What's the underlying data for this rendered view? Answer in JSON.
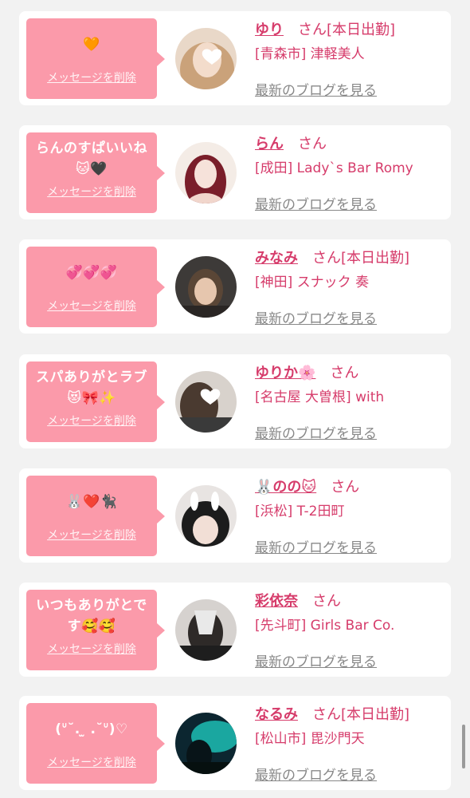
{
  "cards": [
    {
      "message": "🧡",
      "delete_label": "メッセージを削除",
      "name": "ゆり",
      "honorific": "さん",
      "status": "[本日出勤]",
      "shop": "[青森市] 津軽美人",
      "blog_link": "最新のブログを見る"
    },
    {
      "message": "らんのすぱいいね\n🐱🖤",
      "delete_label": "メッセージを削除",
      "name": "らん",
      "honorific": "さん",
      "status": "",
      "shop": "[成田] Lady`s Bar Romy",
      "blog_link": "最新のブログを見る"
    },
    {
      "message": "💞💞💞",
      "delete_label": "メッセージを削除",
      "name": "みなみ",
      "honorific": "さん",
      "status": "[本日出勤]",
      "shop": "[神田] スナック 奏",
      "blog_link": "最新のブログを見る"
    },
    {
      "message": "スパありがとラブ\n😻🎀✨",
      "delete_label": "メッセージを削除",
      "name": "ゆりか🌸",
      "honorific": "さん",
      "status": "",
      "shop": "[名古屋 大曽根] with",
      "blog_link": "最新のブログを見る"
    },
    {
      "message": "🐰❤️🐈‍⬛",
      "delete_label": "メッセージを削除",
      "name": "🐰のの🐱",
      "honorific": "さん",
      "status": "",
      "shop": "[浜松] T-2田町",
      "blog_link": "最新のブログを見る"
    },
    {
      "message": "いつもありがとで\nす🥰🥰",
      "delete_label": "メッセージを削除",
      "name": "彩依奈",
      "honorific": "さん",
      "status": "",
      "shop": "[先斗町] Girls Bar Co.",
      "blog_link": "最新のブログを見る"
    },
    {
      "message": "(ᐡ˘. ̫ .˘ᐡ)♡",
      "delete_label": "メッセージを削除",
      "name": "なるみ",
      "honorific": "さん",
      "status": "[本日出勤]",
      "shop": "[松山市] 毘沙門天",
      "blog_link": "最新のブログを見る"
    }
  ],
  "colors": {
    "bubble": "#fb9aaa",
    "accent_text": "#d63c6b",
    "link_gray": "#888888",
    "page_bg": "#f2f2f2"
  }
}
